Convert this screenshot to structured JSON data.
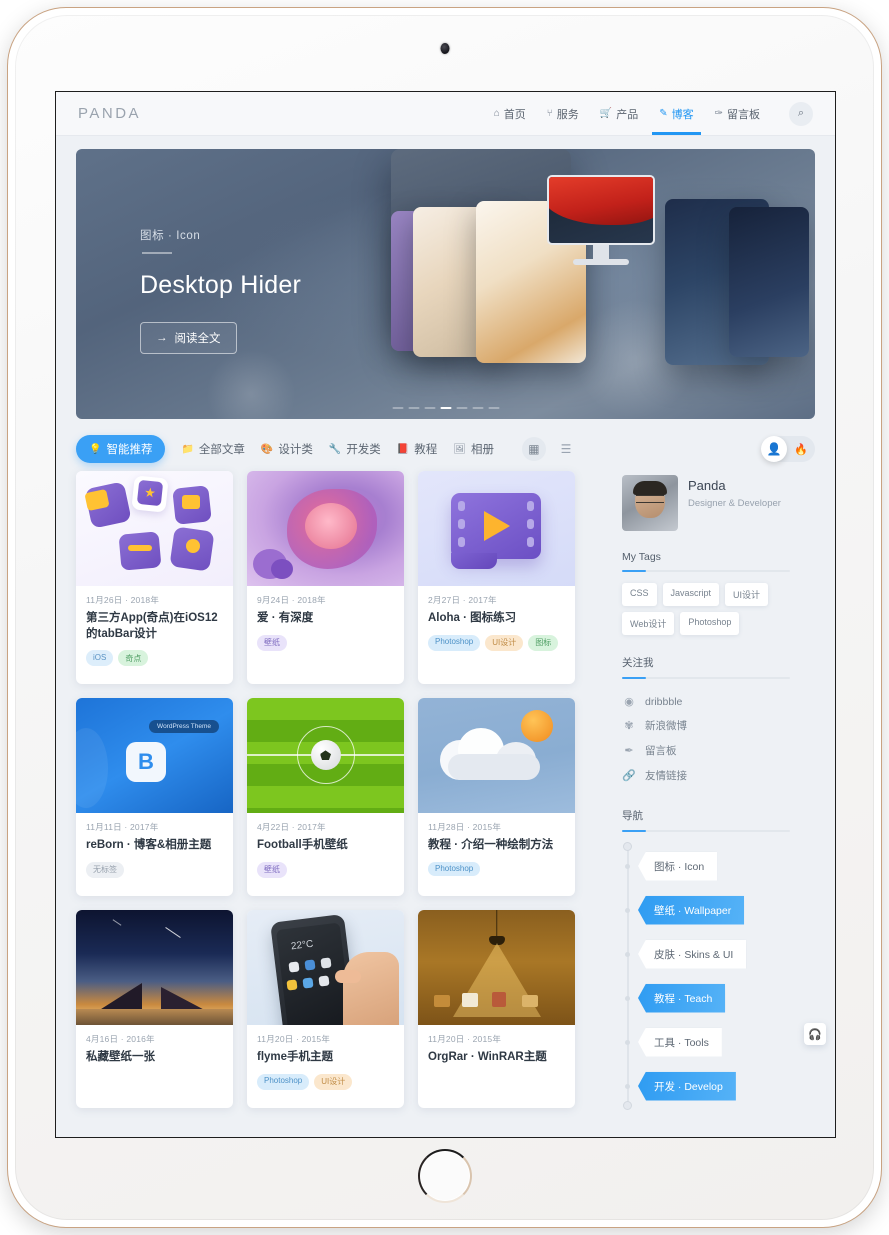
{
  "nav": {
    "logo": "PANDA",
    "items": [
      {
        "label": "首页",
        "icon": "home-icon",
        "glyph": "⌂",
        "active": false
      },
      {
        "label": "服务",
        "icon": "services-icon",
        "glyph": "⑂",
        "active": false
      },
      {
        "label": "产品",
        "icon": "cart-icon",
        "glyph": "🛒",
        "active": false
      },
      {
        "label": "博客",
        "icon": "blog-icon",
        "glyph": "✎",
        "active": true
      },
      {
        "label": "留言板",
        "icon": "message-board-icon",
        "glyph": "✑",
        "active": false
      }
    ],
    "search_icon": "search-icon",
    "search_glyph": "🔍"
  },
  "hero": {
    "category": "图标 · Icon",
    "title": "Desktop Hider",
    "button_label": "阅读全文",
    "button_arrow": "→",
    "carousel": {
      "total": 7,
      "active_index": 3
    }
  },
  "filters": {
    "items": [
      {
        "label": "智能推荐",
        "icon": "bulb-icon",
        "glyph": "💡",
        "active": true
      },
      {
        "label": "全部文章",
        "icon": "folder-icon",
        "glyph": "📁",
        "active": false
      },
      {
        "label": "设计类",
        "icon": "palette-icon",
        "glyph": "🎨",
        "active": false
      },
      {
        "label": "开发类",
        "icon": "wrench-icon",
        "glyph": "🔧",
        "active": false
      },
      {
        "label": "教程",
        "icon": "book-icon",
        "glyph": "📕",
        "active": false
      },
      {
        "label": "相册",
        "icon": "album-icon",
        "glyph": "🖼",
        "active": false
      }
    ],
    "view_grid_icon": "grid-view-icon",
    "view_list_icon": "list-view-icon",
    "user_toggle": {
      "on_icon": "user-icon",
      "off_icon": "flame-icon"
    }
  },
  "cards": [
    {
      "date": "11月26日 · 2018年",
      "title": "第三方App(奇点)在iOS12的tabBar设计",
      "tags": [
        {
          "label": "iOS",
          "style": "t-ios"
        },
        {
          "label": "奇点",
          "style": "t-green"
        }
      ],
      "thumb": "icon-set-purple"
    },
    {
      "date": "9月24日 · 2018年",
      "title": "爱 · 有深度",
      "tags": [
        {
          "label": "壁纸",
          "style": "t-purple"
        }
      ],
      "thumb": "abstract-purple"
    },
    {
      "date": "2月27日 · 2017年",
      "title": "Aloha · 图标练习",
      "tags": [
        {
          "label": "Photoshop",
          "style": "t-blue"
        },
        {
          "label": "UI设计",
          "style": "t-orange"
        },
        {
          "label": "图标",
          "style": "t-green"
        }
      ],
      "thumb": "film-play-icon"
    },
    {
      "date": "11月11日 · 2017年",
      "title": "reBorn · 博客&相册主题",
      "tags": [
        {
          "label": "无标签",
          "style": "t-gray"
        }
      ],
      "thumb": "wordpress-blue"
    },
    {
      "date": "4月22日 · 2017年",
      "title": "Football手机壁纸",
      "tags": [
        {
          "label": "壁纸",
          "style": "t-purple"
        }
      ],
      "thumb": "soccer-field"
    },
    {
      "date": "11月28日 · 2015年",
      "title": "教程 · 介绍一种绘制方法",
      "tags": [
        {
          "label": "Photoshop",
          "style": "t-blue"
        }
      ],
      "thumb": "cloud-sun"
    },
    {
      "date": "4月16日 · 2016年",
      "title": "私藏壁纸一张",
      "tags": [],
      "thumb": "night-mountains"
    },
    {
      "date": "11月20日 · 2015年",
      "title": "flyme手机主题",
      "tags": [
        {
          "label": "Photoshop",
          "style": "t-blue"
        },
        {
          "label": "UI设计",
          "style": "t-orange"
        }
      ],
      "thumb": "phone-in-hand"
    },
    {
      "date": "11月20日 · 2015年",
      "title": "OrgRar · WinRAR主题",
      "tags": [],
      "thumb": "warm-lamp"
    }
  ],
  "sidebar": {
    "profile": {
      "name": "Panda",
      "role": "Designer & Developer",
      "avatar": "avatar"
    },
    "tags_section": {
      "heading": "My Tags",
      "tags": [
        "CSS",
        "Javascript",
        "UI设计",
        "Web设计",
        "Photoshop"
      ]
    },
    "follow_section": {
      "heading": "关注我",
      "links": [
        {
          "label": "dribbble",
          "icon": "dribbble-icon",
          "glyph": "◉"
        },
        {
          "label": "新浪微博",
          "icon": "weibo-icon",
          "glyph": "✾"
        },
        {
          "label": "留言板",
          "icon": "pen-icon",
          "glyph": "✒"
        },
        {
          "label": "友情链接",
          "icon": "link-icon",
          "glyph": "🔗"
        }
      ]
    },
    "nav_section": {
      "heading": "导航",
      "items": [
        {
          "label": "图标 · Icon",
          "style": "white"
        },
        {
          "label": "壁纸 · Wallpaper",
          "style": "blue"
        },
        {
          "label": "皮肤 · Skins & UI",
          "style": "white"
        },
        {
          "label": "教程 · Teach",
          "style": "blue"
        },
        {
          "label": "工具 · Tools",
          "style": "white"
        },
        {
          "label": "开发 · Develop",
          "style": "blue"
        }
      ]
    }
  },
  "float_button": {
    "icon": "headphones-icon",
    "glyph": "🎧"
  },
  "colors": {
    "accent": "#3aa0f5",
    "page_bg": "#eef1f5",
    "card_bg": "#ffffff",
    "text": "#3c4654"
  }
}
